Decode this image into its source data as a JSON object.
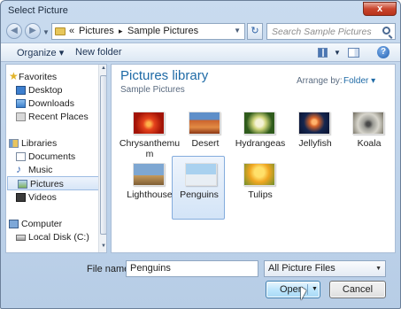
{
  "window": {
    "title": "Select Picture",
    "close_glyph": "x"
  },
  "navigation": {
    "back_glyph": "◀",
    "forward_glyph": "▶",
    "breadcrumb": {
      "prefix": "«",
      "items": [
        "Pictures",
        "Sample Pictures"
      ],
      "separator": "▸"
    },
    "refresh_glyph": "↻",
    "search": {
      "placeholder": "Search Sample Pictures"
    }
  },
  "toolbar": {
    "organize_label": "Organize ▾",
    "new_folder_label": "New folder",
    "help_glyph": "?"
  },
  "sidebar": {
    "groups": [
      {
        "label": "Favorites",
        "icon": "star-icon",
        "items": [
          {
            "label": "Desktop",
            "icon": "desktop-icon"
          },
          {
            "label": "Downloads",
            "icon": "downloads-icon"
          },
          {
            "label": "Recent Places",
            "icon": "recent-places-icon"
          }
        ]
      },
      {
        "label": "Libraries",
        "icon": "libraries-icon",
        "items": [
          {
            "label": "Documents",
            "icon": "documents-icon"
          },
          {
            "label": "Music",
            "icon": "music-icon"
          },
          {
            "label": "Pictures",
            "icon": "pictures-icon",
            "selected": true
          },
          {
            "label": "Videos",
            "icon": "videos-icon"
          }
        ]
      },
      {
        "label": "Computer",
        "icon": "computer-icon",
        "items": [
          {
            "label": "Local Disk (C:)",
            "icon": "disk-icon"
          }
        ]
      }
    ]
  },
  "main": {
    "library_title": "Pictures library",
    "library_subtitle": "Sample Pictures",
    "arrange_label": "Arrange by:",
    "arrange_value": "Folder ▾",
    "items": [
      {
        "label": "Chrysanthemum",
        "icon": "chrysanthemum-thumbnail",
        "selected": false
      },
      {
        "label": "Desert",
        "icon": "desert-thumbnail",
        "selected": false
      },
      {
        "label": "Hydrangeas",
        "icon": "hydrangeas-thumbnail",
        "selected": false
      },
      {
        "label": "Jellyfish",
        "icon": "jellyfish-thumbnail",
        "selected": false
      },
      {
        "label": "Koala",
        "icon": "koala-thumbnail",
        "selected": false
      },
      {
        "label": "Lighthouse",
        "icon": "lighthouse-thumbnail",
        "selected": false
      },
      {
        "label": "Penguins",
        "icon": "penguins-thumbnail",
        "selected": true
      },
      {
        "label": "Tulips",
        "icon": "tulips-thumbnail",
        "selected": false
      }
    ]
  },
  "footer": {
    "filename_label": "File name:",
    "filename_value": "Penguins",
    "filter_value": "All Picture Files",
    "open_label": "Open",
    "cancel_label": "Cancel"
  },
  "colors": {
    "accent": "#1e6aa6",
    "selection": "#d3e4f7",
    "window_chrome": "#c9dbef"
  }
}
